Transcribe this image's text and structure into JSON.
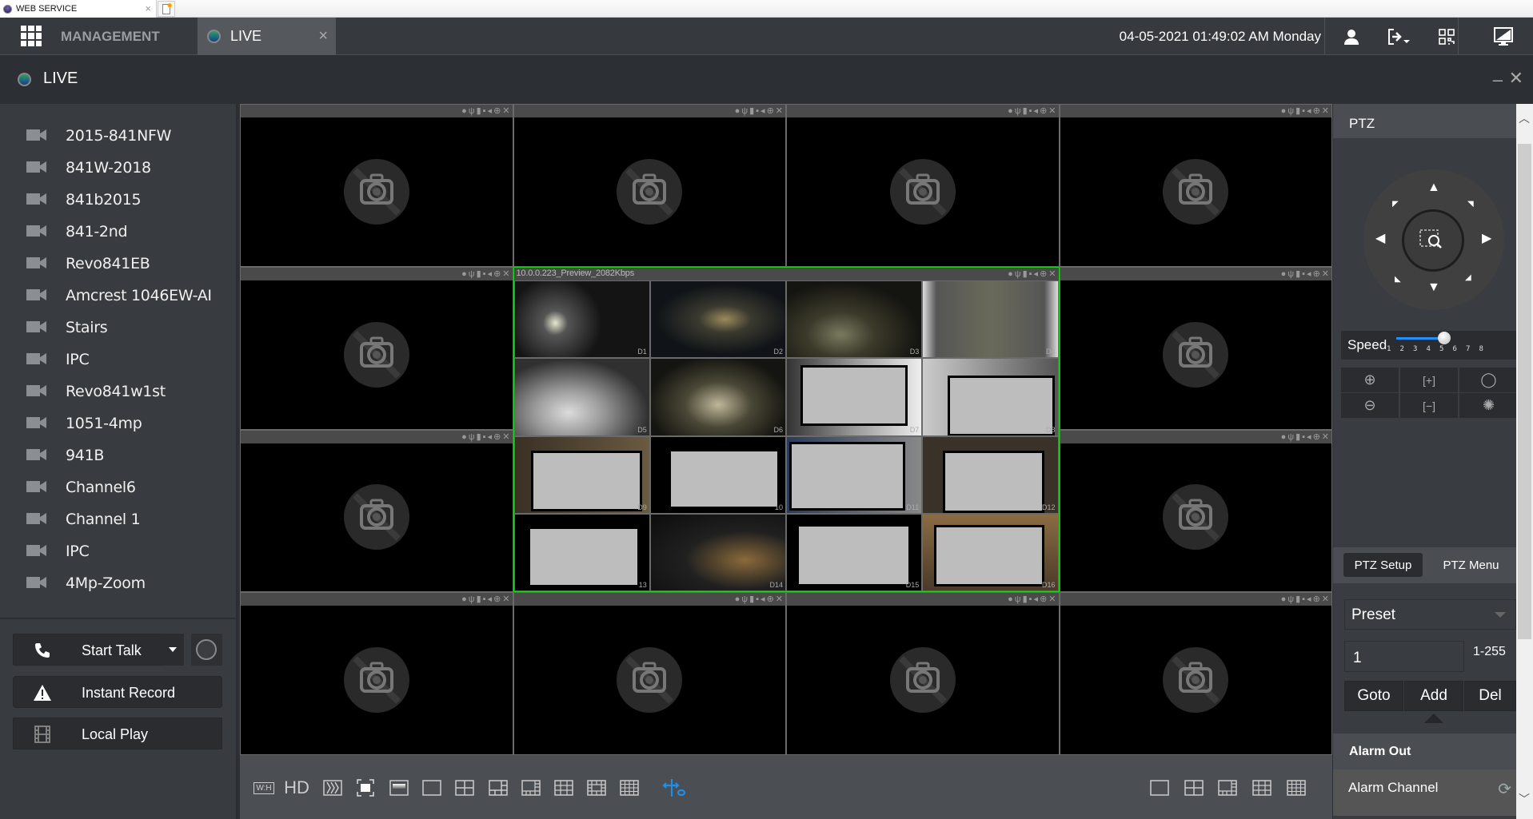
{
  "browser": {
    "tab_title": "WEB SERVICE",
    "close_glyph": "×"
  },
  "nav": {
    "management_label": "MANAGEMENT",
    "live_tab_label": "LIVE",
    "live_tab_close": "×",
    "datetime": "04-05-2021 01:49:02 AM Monday",
    "icons": [
      "user-icon",
      "logout-icon",
      "qr-code-icon",
      "fullscreen-monitor-icon"
    ]
  },
  "live_header": {
    "title": "LIVE",
    "minimize": "–",
    "close": "✕"
  },
  "sidebar": {
    "cameras": [
      {
        "label": "2015-841NFW"
      },
      {
        "label": "841W-2018"
      },
      {
        "label": "841b2015"
      },
      {
        "label": "841-2nd"
      },
      {
        "label": "Revo841EB"
      },
      {
        "label": "Amcrest 1046EW-AI"
      },
      {
        "label": "Stairs"
      },
      {
        "label": "IPC"
      },
      {
        "label": "Revo841w1st"
      },
      {
        "label": "1051-4mp"
      },
      {
        "label": "941B"
      },
      {
        "label": "Channel6"
      },
      {
        "label": "Channel 1"
      },
      {
        "label": "IPC"
      },
      {
        "label": "4Mp-Zoom"
      }
    ],
    "buttons": {
      "start_talk": "Start Talk",
      "instant_record": "Instant Record",
      "local_play": "Local Play"
    }
  },
  "grid": {
    "layout": "4x4",
    "active_cell_title": "10.0.0.223_Preview_2082Kbps",
    "cell_tool_icons": [
      "eye-icon",
      "mic-icon",
      "record-icon",
      "snapshot-icon",
      "audio-icon",
      "zoom-icon",
      "close-icon"
    ],
    "active_sub_labels": [
      "D1",
      "D2",
      "D3",
      "D4",
      "D5",
      "D6",
      "D7",
      "D8",
      "D9",
      "10",
      "D11",
      "D12",
      "13",
      "D14",
      "D15",
      "D16"
    ]
  },
  "toolbar": {
    "left": [
      "W:H",
      "HD",
      "image-adjust",
      "fullscreen",
      "window-mode",
      "1-split",
      "4-split",
      "6-split",
      "8-split",
      "9-split",
      "13-split",
      "16-split",
      "ptz-fisheye"
    ],
    "right": [
      "1-split",
      "4-split",
      "8-split",
      "9-split",
      "16-split"
    ],
    "accent": "#1e8fe8"
  },
  "ptz": {
    "title": "PTZ",
    "speed_label": "Speed",
    "speed_ticks": [
      "1",
      "2",
      "3",
      "4",
      "5",
      "6",
      "7",
      "8"
    ],
    "speed_value": 5,
    "tabs": {
      "setup": "PTZ Setup",
      "menu": "PTZ Menu"
    },
    "mode_select": "Preset",
    "preset_value": "1",
    "preset_range": "1-255",
    "actions": {
      "goto": "Goto",
      "add": "Add",
      "del": "Del"
    },
    "alarm_out": "Alarm Out",
    "alarm_channel": "Alarm Channel"
  }
}
